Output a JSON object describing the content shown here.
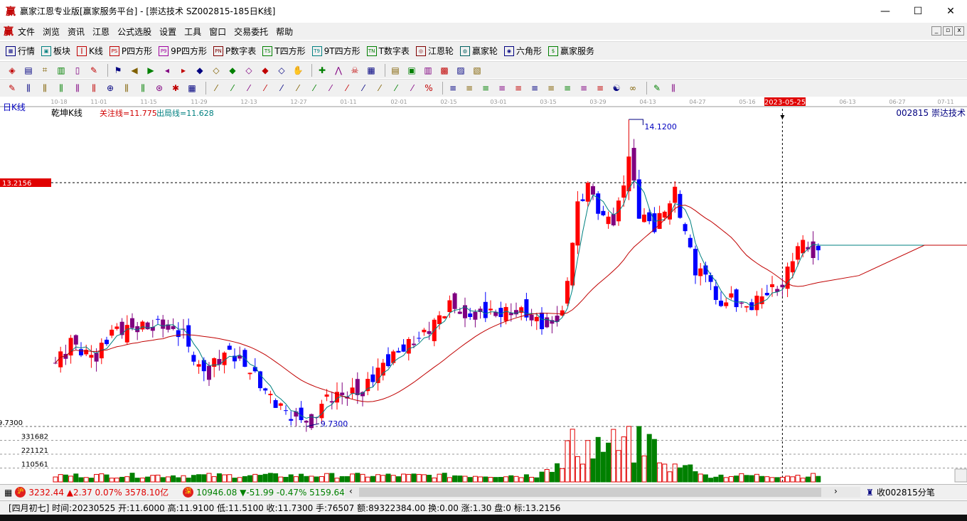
{
  "window": {
    "logo": "赢",
    "title": "赢家江恩专业版[赢家服务平台] - [崇达技术  SZ002815-185日K线]",
    "minimize": "—",
    "maximize": "☐",
    "close": "✕"
  },
  "menu": {
    "logo": "赢",
    "items": [
      "文件",
      "浏览",
      "资讯",
      "江恩",
      "公式选股",
      "设置",
      "工具",
      "窗口",
      "交易委托",
      "帮助"
    ]
  },
  "toolbar1": [
    {
      "icon": "grid-icon",
      "glyph": "▦",
      "label": "行情",
      "color": "#000080"
    },
    {
      "icon": "blocks-icon",
      "glyph": "▣",
      "label": "板块",
      "color": "#008080"
    },
    {
      "icon": "kline-icon",
      "glyph": "┃",
      "label": "K线",
      "color": "#c00000"
    },
    {
      "icon": "ps-icon",
      "glyph": "PS",
      "label": "P四方形",
      "color": "#c00000"
    },
    {
      "icon": "p9-icon",
      "glyph": "P9",
      "label": "9P四方形",
      "color": "#a000a0"
    },
    {
      "icon": "pn-icon",
      "glyph": "PN",
      "label": "P数字表",
      "color": "#800000"
    },
    {
      "icon": "ts-icon",
      "glyph": "TS",
      "label": "T四方形",
      "color": "#008000"
    },
    {
      "icon": "t9-icon",
      "glyph": "T9",
      "label": "9T四方形",
      "color": "#008080"
    },
    {
      "icon": "tn-icon",
      "glyph": "TN",
      "label": "T数字表",
      "color": "#008000"
    },
    {
      "icon": "gann-wheel-icon",
      "glyph": "◎",
      "label": "江恩轮",
      "color": "#800000"
    },
    {
      "icon": "winner-wheel-icon",
      "glyph": "◍",
      "label": "赢家轮",
      "color": "#006060"
    },
    {
      "icon": "hexagon-icon",
      "glyph": "◉",
      "label": "六角形",
      "color": "#000080"
    },
    {
      "icon": "dollar-icon",
      "glyph": "$",
      "label": "赢家服务",
      "color": "#008000"
    }
  ],
  "toolbar2": [
    "period-dropdown-icon",
    "pattern-icon",
    "document-icon",
    "chart-icon",
    "bar-chart-icon",
    "cursor-dropdown-icon",
    "formula-icon",
    "flag-icon",
    "first-icon",
    "last-icon",
    "prev-icon",
    "next-icon",
    "diamond1-icon",
    "diamond2-icon",
    "diamond3-icon",
    "diamond4-icon",
    "diamond5-icon",
    "diamond6-icon",
    "hand-icon",
    "crosshair-icon",
    "line-icon",
    "skull-icon",
    "calendar-icon",
    "calc-icon",
    "notes-icon",
    "save-icon",
    "print-icon",
    "export-icon"
  ],
  "toolbar3": [
    "pen-icon",
    "bars1-icon",
    "bars2-icon",
    "bars3-icon",
    "bars4-icon",
    "bars5-icon",
    "circle-icon",
    "grid1-icon",
    "grid2-icon",
    "gann-angle-icon",
    "star-icon",
    "box-icon",
    "fan1-icon",
    "fan2-icon",
    "fan3-icon",
    "fan4-icon",
    "fan5-icon",
    "fan6-icon",
    "fan7-icon",
    "fan8-icon",
    "fan9-icon",
    "fan10-icon",
    "fan11-icon",
    "fan12-icon",
    "fan13-icon",
    "fan14-icon",
    "fan15-icon",
    "percent-icon",
    "fib1-icon",
    "fib2-icon",
    "fib3-icon",
    "fib4-icon",
    "fib5-icon",
    "fib6-icon",
    "fib7-icon",
    "fib8-icon",
    "fib9-icon",
    "fib10-icon",
    "yin-yang-icon",
    "infinity-icon"
  ],
  "chart": {
    "period_label": "日K线",
    "indicator_name": "乾坤K线",
    "focus_line": "关注线=11.775",
    "exit_line": "出局线=11.628",
    "stock": "002815  崇达技术",
    "date_ticks": [
      "10-18",
      "11-01",
      "11-15",
      "11-29",
      "12-13",
      "12-27",
      "01-11",
      "02-01",
      "02-15",
      "03-01",
      "03-15",
      "03-29",
      "04-13",
      "04-27",
      "05-16",
      "06-13",
      "06-27",
      "07-11"
    ],
    "cursor_date": "2023-05-25",
    "cursor_price": "13.2156",
    "high_label": "14.1200",
    "low_label": "9.7300",
    "low_axis_label": "9.7300",
    "volume_ticks": [
      "331682",
      "221121",
      "110561"
    ],
    "colors": {
      "up": "#ff0000",
      "down": "#0000ff",
      "neutral": "#800080",
      "ma_short": "#008080",
      "ma_long": "#c00000"
    }
  },
  "chart_data": {
    "type": "candlestick",
    "price_range": [
      9.73,
      14.12
    ],
    "cursor_price": 13.2156,
    "cursor_index": 142,
    "close_anchors": [
      [
        0,
        10.64
      ],
      [
        3,
        10.95
      ],
      [
        6,
        10.75
      ],
      [
        9,
        10.85
      ],
      [
        11,
        11.1
      ],
      [
        17,
        11.15
      ],
      [
        21,
        11.2
      ],
      [
        25,
        11.05
      ],
      [
        28,
        10.54
      ],
      [
        31,
        10.64
      ],
      [
        34,
        10.8
      ],
      [
        38,
        10.54
      ],
      [
        42,
        10.14
      ],
      [
        46,
        9.88
      ],
      [
        50,
        9.83
      ],
      [
        53,
        10.14
      ],
      [
        57,
        10.19
      ],
      [
        60,
        10.24
      ],
      [
        63,
        10.54
      ],
      [
        67,
        10.8
      ],
      [
        72,
        11.05
      ],
      [
        77,
        11.46
      ],
      [
        81,
        11.36
      ],
      [
        86,
        11.36
      ],
      [
        92,
        11.36
      ],
      [
        95,
        11.2
      ],
      [
        99,
        11.31
      ],
      [
        100,
        11.86
      ],
      [
        102,
        12.88
      ],
      [
        104,
        13.18
      ],
      [
        107,
        12.68
      ],
      [
        110,
        12.88
      ],
      [
        112,
        13.59
      ],
      [
        114,
        12.78
      ],
      [
        117,
        12.58
      ],
      [
        121,
        13.08
      ],
      [
        122,
        12.78
      ],
      [
        125,
        11.97
      ],
      [
        128,
        11.86
      ],
      [
        129,
        11.46
      ],
      [
        132,
        11.56
      ],
      [
        135,
        11.41
      ],
      [
        139,
        11.66
      ],
      [
        142,
        11.73
      ],
      [
        144,
        12.17
      ],
      [
        146,
        12.37
      ],
      [
        149,
        12.27
      ]
    ],
    "volume_max": 450000
  },
  "ticker": {
    "sh_badge": "沪",
    "sh": "3232.44 ▲2.37 0.07% 3578.10亿",
    "sz_badge": "深",
    "sz": "10946.08 ▼-51.99 -0.47% 5159.64",
    "scroll_left": "‹",
    "scroll_right": "›",
    "right_text": "收002815分笔"
  },
  "status": "[四月初七] 时间:20230525 开:11.6000 高:11.9100 低:11.5100 收:11.7300 手:76507 额:89322384.00 换:0.00 涨:1.30 盘:0 标:13.2156"
}
